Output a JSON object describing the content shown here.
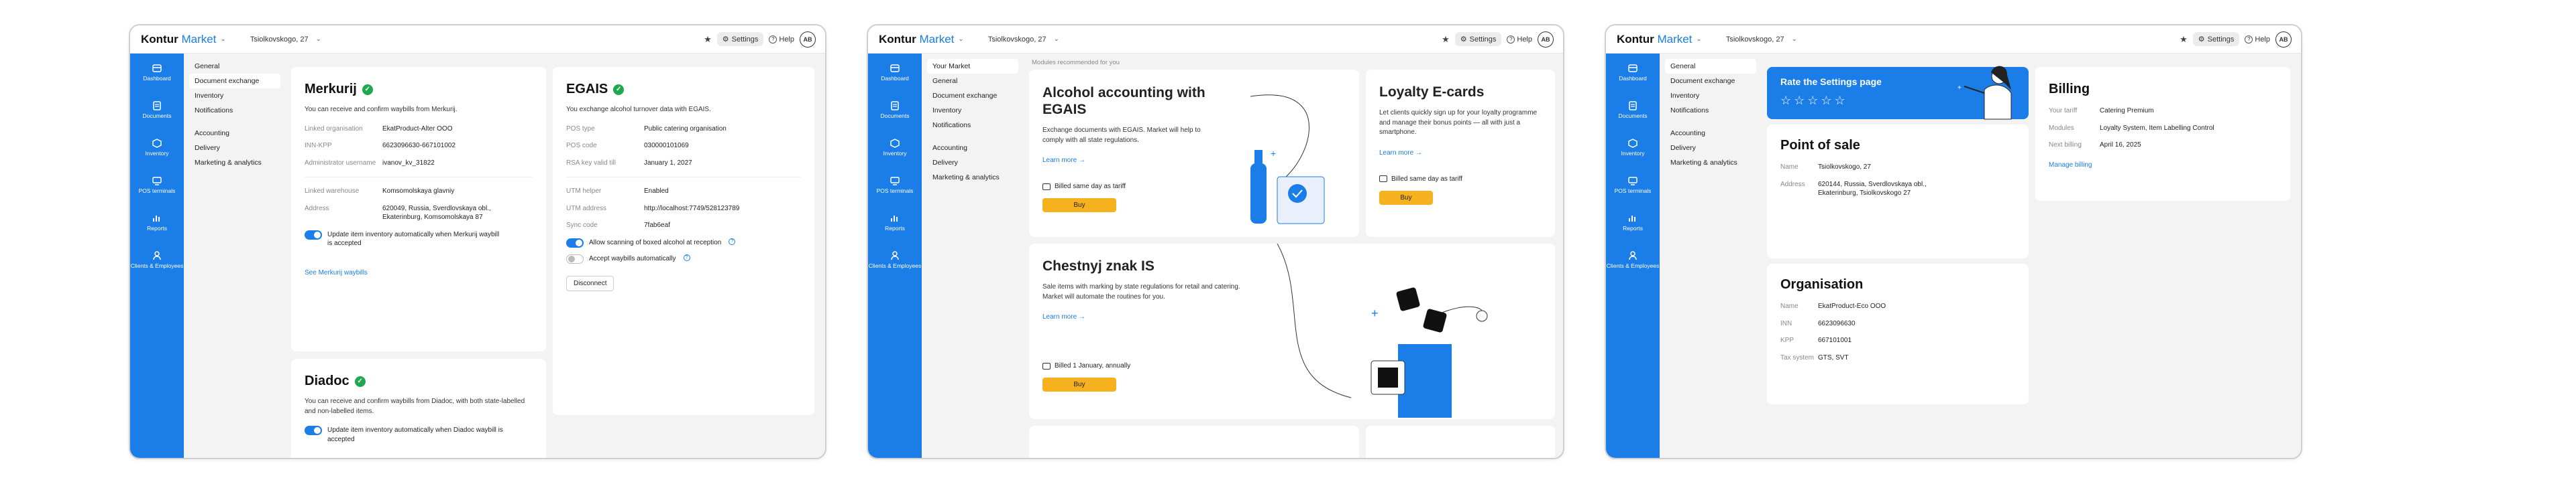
{
  "common": {
    "brand": "Kontur",
    "brand_product": "Market",
    "address": "Tsiolkovskogo, 27",
    "settings_label": "Settings",
    "help_label": "Help",
    "avatar_initials": "AB"
  },
  "sidebar": {
    "items": [
      {
        "label": "Dashboard",
        "icon": "dashboard-icon"
      },
      {
        "label": "Documents",
        "icon": "documents-icon"
      },
      {
        "label": "Inventory",
        "icon": "inventory-icon"
      },
      {
        "label": "POS terminals",
        "icon": "pos-terminal-icon"
      },
      {
        "label": "Reports",
        "icon": "reports-icon"
      },
      {
        "label": "Clients & Employees",
        "icon": "clients-icon"
      }
    ]
  },
  "colors": {
    "accent": "#1a7de8",
    "success": "#1fa84f",
    "buy": "#f5b21e"
  },
  "screen1": {
    "subnav": [
      "General",
      "Document exchange",
      "Inventory",
      "Notifications",
      "Accounting",
      "Delivery",
      "Marketing & analytics"
    ],
    "merkurij": {
      "title": "Merkurij",
      "desc": "You can receive and confirm waybills from Merkurij.",
      "rows": [
        {
          "k": "Linked organisation",
          "v": "EkatProduct-Alter OOO"
        },
        {
          "k": "INN-KPP",
          "v": "6623096630-667101002"
        },
        {
          "k": "Administrator username",
          "v": "ivanov_kv_31822"
        },
        {
          "k": "Linked warehouse",
          "v": "Komsomolskaya glavniy"
        },
        {
          "k": "Address",
          "v": "620049, Russia, Sverdlovskaya obl., Ekaterinburg, Komsomolskaya 87"
        }
      ],
      "toggle_text": "Update item inventory automatically when Merkurij waybill is accepted",
      "link": "See Merkurij waybills"
    },
    "egais": {
      "title": "EGAIS",
      "desc": "You exchange alcohol turnover data with EGAIS.",
      "rows": [
        {
          "k": "POS type",
          "v": "Public catering organisation"
        },
        {
          "k": "POS code",
          "v": "030000101069"
        },
        {
          "k": "RSA key valid till",
          "v": "January 1, 2027"
        },
        {
          "k": "UTM helper",
          "v": "Enabled"
        },
        {
          "k": "UTM address",
          "v": "http://localhost:7749/528123789"
        },
        {
          "k": "Sync code",
          "v": "7fab6eaf"
        }
      ],
      "toggle1": "Allow scanning of boxed alcohol at reception",
      "toggle2": "Accept waybills automatically",
      "disconnect": "Disconnect"
    },
    "diadoc": {
      "title": "Diadoc",
      "desc": "You can receive and confirm waybills from Diadoc, with both state-labelled and non-labelled items.",
      "toggle_text": "Update item inventory automatically when Diadoc waybill is accepted"
    }
  },
  "screen2": {
    "subnav": [
      "Your Market",
      "General",
      "Document exchange",
      "Inventory",
      "Notifications",
      "Accounting",
      "Delivery",
      "Marketing & analytics"
    ],
    "recommended": "Modules recommended for you",
    "alcohol": {
      "title": "Alcohol accounting with EGAIS",
      "desc": "Exchange documents with EGAIS. Market will help to comply with all state regulations.",
      "learn": "Learn more",
      "billed": "Billed same day as tariff",
      "buy": "Buy"
    },
    "loyalty": {
      "title": "Loyalty E-cards",
      "desc": "Let clients quickly sign up for your loyalty programme and manage their bonus points — all with just a smartphone.",
      "learn": "Learn more",
      "billed": "Billed same day as tariff",
      "buy": "Buy"
    },
    "chestnyj": {
      "title": "Chestnyj znak IS",
      "desc": "Sale items with marking by state regulations for retail and catering. Market will automate the routines for you.",
      "learn": "Learn more",
      "billed": "Billed 1 January, annually",
      "buy": "Buy"
    }
  },
  "screen3": {
    "subnav": [
      "General",
      "Document exchange",
      "Inventory",
      "Notifications",
      "Accounting",
      "Delivery",
      "Marketing & analytics"
    ],
    "rate": {
      "title": "Rate the Settings page",
      "stars": 5
    },
    "pos": {
      "title": "Point of sale",
      "rows": [
        {
          "k": "Name",
          "v": "Tsiolkovskogo, 27"
        },
        {
          "k": "Address",
          "v": "620144, Russia, Sverdlovskaya obl., Ekaterinburg, Tsiolkovskogo 27"
        }
      ]
    },
    "org": {
      "title": "Organisation",
      "rows": [
        {
          "k": "Name",
          "v": "EkatProduct-Eco OOO"
        },
        {
          "k": "INN",
          "v": "6623096630"
        },
        {
          "k": "KPP",
          "v": "667101001"
        },
        {
          "k": "Tax system",
          "v": "GTS, SVT"
        }
      ]
    },
    "billing": {
      "title": "Billing",
      "rows": [
        {
          "k": "Your tariff",
          "v": "Catering Premium"
        },
        {
          "k": "Modules",
          "v": "Loyalty System, Item Labelling Control"
        },
        {
          "k": "Next billing",
          "v": "April 16, 2025"
        }
      ],
      "link": "Manage billing"
    }
  }
}
